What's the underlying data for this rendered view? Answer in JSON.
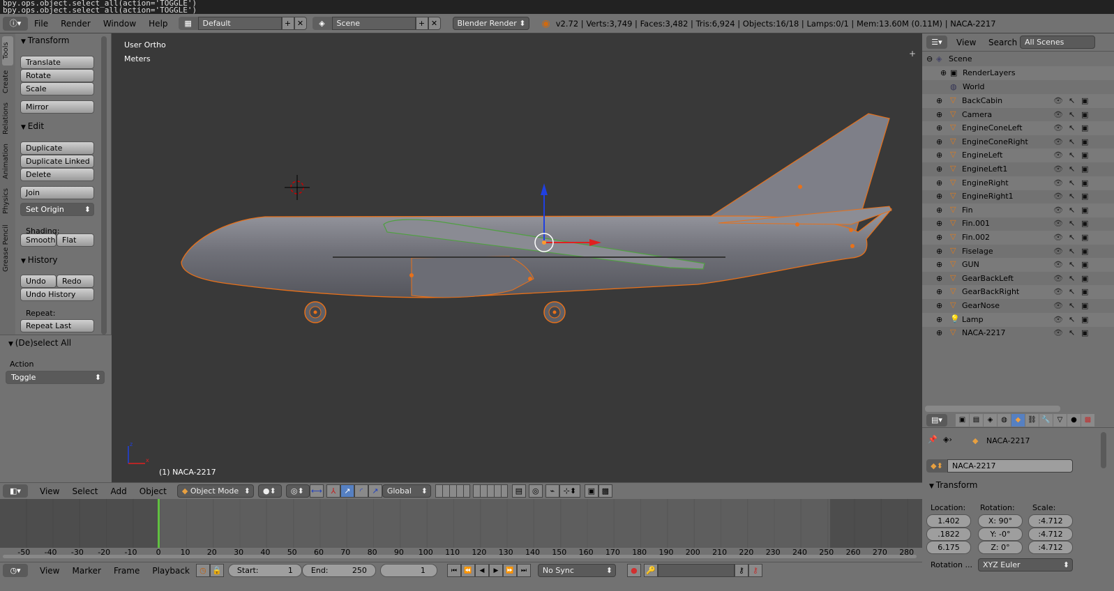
{
  "console": {
    "line1": "bpy.ops.object.select_all(action='TOGGLE')",
    "line2": "bpy.ops.object.select_all(action='TOGGLE')"
  },
  "topbar": {
    "menus": [
      "File",
      "Render",
      "Window",
      "Help"
    ],
    "screen_layout": "Default",
    "scene": "Scene",
    "render_engine": "Blender Render",
    "stats": "v2.72 | Verts:3,749 | Faces:3,482 | Tris:6,924 | Objects:16/18 | Lamps:0/1 | Mem:13.60M (0.11M) | NACA-2217"
  },
  "toolshelf": {
    "tabs": [
      "Tools",
      "Create",
      "Relations",
      "Animation",
      "Physics",
      "Grease Pencil"
    ],
    "transform_title": "Transform",
    "translate": "Translate",
    "rotate": "Rotate",
    "scale": "Scale",
    "mirror": "Mirror",
    "edit_title": "Edit",
    "duplicate": "Duplicate",
    "duplicate_linked": "Duplicate Linked",
    "delete": "Delete",
    "join": "Join",
    "set_origin": "Set Origin",
    "shading_label": "Shading:",
    "smooth": "Smooth",
    "flat": "Flat",
    "history_title": "History",
    "undo": "Undo",
    "redo": "Redo",
    "undo_history": "Undo History",
    "repeat_label": "Repeat:",
    "repeat_last": "Repeat Last",
    "operator_title": "(De)select All",
    "action_label": "Action",
    "action_value": "Toggle"
  },
  "viewport": {
    "view_name": "User Ortho",
    "units": "Meters",
    "selected_object": "(1) NACA-2217"
  },
  "viewport_header": {
    "menus": [
      "View",
      "Select",
      "Add",
      "Object"
    ],
    "mode": "Object Mode",
    "orientation": "Global"
  },
  "outliner": {
    "menus": [
      "View",
      "Search"
    ],
    "filter": "All Scenes",
    "scene": "Scene",
    "render_layers": "RenderLayers",
    "world": "World",
    "objects": [
      "BackCabin",
      "Camera",
      "EngineConeLeft",
      "EngineConeRight",
      "EngineLeft",
      "EngineLeft1",
      "EngineRight",
      "EngineRight1",
      "Fin",
      "Fin.001",
      "Fin.002",
      "Fiselage",
      "GUN",
      "GearBackLeft",
      "GearBackRight",
      "GearNose",
      "Lamp",
      "NACA-2217"
    ]
  },
  "properties": {
    "breadcrumb_object": "NACA-2217",
    "object_name": "NACA-2217",
    "transform_title": "Transform",
    "location_label": "Location:",
    "rotation_label": "Rotation:",
    "scale_label": "Scale:",
    "location": [
      "1.402",
      ".1822",
      "6.175"
    ],
    "rotation": [
      "X: 90°",
      "Y:  -0°",
      "Z:   0°"
    ],
    "scale": [
      ":4.712",
      ":4.712",
      ":4.712"
    ],
    "rotation_mode_label": "Rotation ...",
    "rotation_mode": "XYZ Euler"
  },
  "timeline": {
    "menus": [
      "View",
      "Marker",
      "Frame",
      "Playback"
    ],
    "ticks": [
      "-50",
      "-40",
      "-30",
      "-20",
      "-10",
      "0",
      "10",
      "20",
      "30",
      "40",
      "50",
      "60",
      "70",
      "80",
      "90",
      "100",
      "110",
      "120",
      "130",
      "140",
      "150",
      "160",
      "170",
      "180",
      "190",
      "200",
      "210",
      "220",
      "230",
      "240",
      "250",
      "260",
      "270",
      "280"
    ],
    "start_label": "Start:",
    "start": "1",
    "end_label": "End:",
    "end": "250",
    "current_frame": "1",
    "sync": "No Sync"
  },
  "colors": {
    "selection_outline": "#e8711a",
    "active_object": "#ff9a2e",
    "current_frame": "#60c040"
  }
}
